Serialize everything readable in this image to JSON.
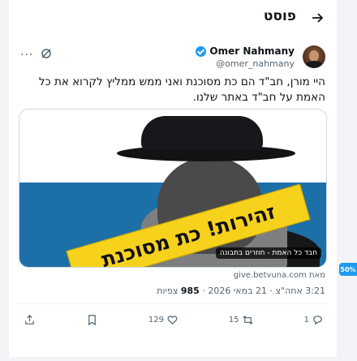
{
  "header": {
    "title": "פוסט"
  },
  "author": {
    "display_name": "Omer Nahmany",
    "handle": "@omer_nahmany",
    "more_label": "···"
  },
  "tweet": {
    "text": "היי מורן, חב\"ד הם כת מסוכנת ואני ממש ממליץ לקרוא את כל האמת על חב\"ד באתר שלנו."
  },
  "media": {
    "banner_text": "זהירות! כת מסוכנת",
    "caption": "חבד כל האמת - חוזרים בתבונה",
    "source": "מאת give.betvuna.com"
  },
  "meta": {
    "time": "3:21 אחה\"צ",
    "date": "21 במאי 2026",
    "views_count": "985",
    "views_label": "צפיות",
    "separator": "·"
  },
  "actions": {
    "replies": "1",
    "retweets": "15",
    "likes": "129"
  },
  "side_badge": "50%",
  "colors": {
    "accent": "#1d9bf0",
    "banner": "#f7d21d"
  }
}
